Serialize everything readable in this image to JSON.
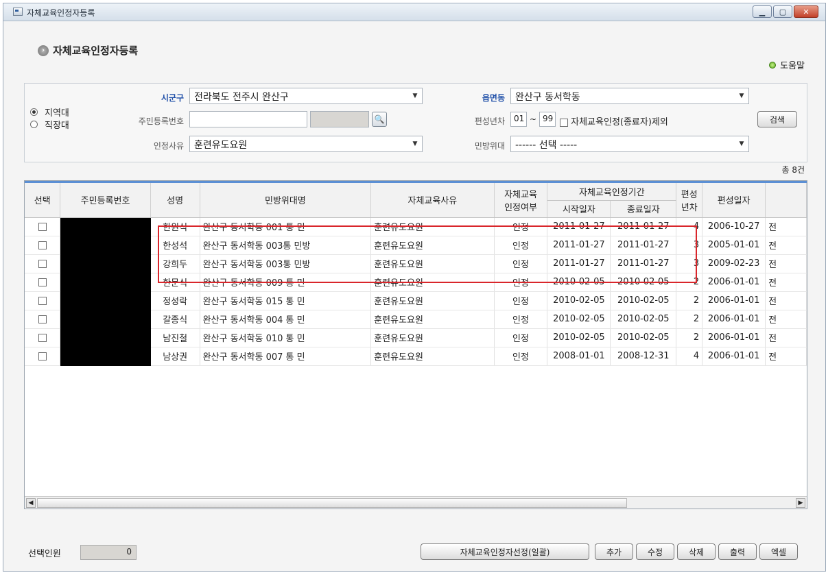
{
  "window": {
    "title": "자체교육인정자등록"
  },
  "page": {
    "heading": "자체교육인정자등록",
    "help_label": "도움말"
  },
  "search": {
    "radios": [
      {
        "label": "지역대",
        "checked": true
      },
      {
        "label": "직장대",
        "checked": false
      }
    ],
    "sigungu_label": "시군구",
    "sigungu_value": "전라북도 전주시 완산구",
    "eupmyeondong_label": "읍면동",
    "eupmyeondong_value": "완산구 동서학동",
    "rrn_label": "주민등록번호",
    "rrn_value": "",
    "pyeonseong_label": "편성년차",
    "year_from": "01",
    "year_sep": "~",
    "year_to": "99",
    "exclude_label": "자체교육인정(종료자)제외",
    "reason_label": "인정사유",
    "reason_value": "훈련유도요원",
    "minbang_label": "민방위대",
    "minbang_value": "------ 선택 -----",
    "search_button": "검색"
  },
  "total_label": "총 8건",
  "grid": {
    "headers": {
      "select": "선택",
      "rrn": "주민등록번호",
      "name": "성명",
      "unit": "민방위대명",
      "reason": "자체교육사유",
      "approved_1": "자체교육",
      "approved_2": "인정여부",
      "period": "자체교육인정기간",
      "start": "시작일자",
      "end": "종료일자",
      "year_1": "편성",
      "year_2": "년차",
      "date": "편성일자"
    },
    "rows": [
      {
        "name": "한원식",
        "unit": "완산구 동서학동 001 통 민",
        "reason": "훈련유도요원",
        "approved": "인정",
        "start": "2011-01-27",
        "end": "2011-01-27",
        "year": "4",
        "date": "2006-10-27",
        "extra": "전"
      },
      {
        "name": "한성석",
        "unit": "완산구 동서학동 003통 민방",
        "reason": "훈련유도요원",
        "approved": "인정",
        "start": "2011-01-27",
        "end": "2011-01-27",
        "year": "3",
        "date": "2005-01-01",
        "extra": "전"
      },
      {
        "name": "강희두",
        "unit": "완산구 동서학동 003통 민방",
        "reason": "훈련유도요원",
        "approved": "인정",
        "start": "2011-01-27",
        "end": "2011-01-27",
        "year": "3",
        "date": "2009-02-23",
        "extra": "전"
      },
      {
        "name": "한문식",
        "unit": "완산구 동서학동 009 통 민",
        "reason": "훈련유도요원",
        "approved": "인정",
        "start": "2010-02-05",
        "end": "2010-02-05",
        "year": "2",
        "date": "2006-01-01",
        "extra": "전"
      },
      {
        "name": "정성락",
        "unit": "완산구 동서학동 015 통 민",
        "reason": "훈련유도요원",
        "approved": "인정",
        "start": "2010-02-05",
        "end": "2010-02-05",
        "year": "2",
        "date": "2006-01-01",
        "extra": "전"
      },
      {
        "name": "갈종식",
        "unit": "완산구 동서학동 004 통 민",
        "reason": "훈련유도요원",
        "approved": "인정",
        "start": "2010-02-05",
        "end": "2010-02-05",
        "year": "2",
        "date": "2006-01-01",
        "extra": "전"
      },
      {
        "name": "남진철",
        "unit": "완산구 동서학동 010 통 민",
        "reason": "훈련유도요원",
        "approved": "인정",
        "start": "2010-02-05",
        "end": "2010-02-05",
        "year": "2",
        "date": "2006-01-01",
        "extra": "전"
      },
      {
        "name": "남상권",
        "unit": "완산구 동서학동 007 통 민",
        "reason": "훈련유도요원",
        "approved": "인정",
        "start": "2008-01-01",
        "end": "2008-12-31",
        "year": "4",
        "date": "2006-01-01",
        "extra": "전"
      }
    ]
  },
  "footer": {
    "selected_label": "선택인원",
    "selected_count": "0",
    "buttons": {
      "bulk": "자체교육인정자선정(일괄)",
      "add": "추가",
      "edit": "수정",
      "delete": "삭제",
      "print": "출력",
      "excel": "엑셀"
    }
  },
  "colors": {
    "highlight": "#d9262b",
    "grid_accent": "#5b8fd4",
    "label_blue": "#1f4fa8"
  }
}
